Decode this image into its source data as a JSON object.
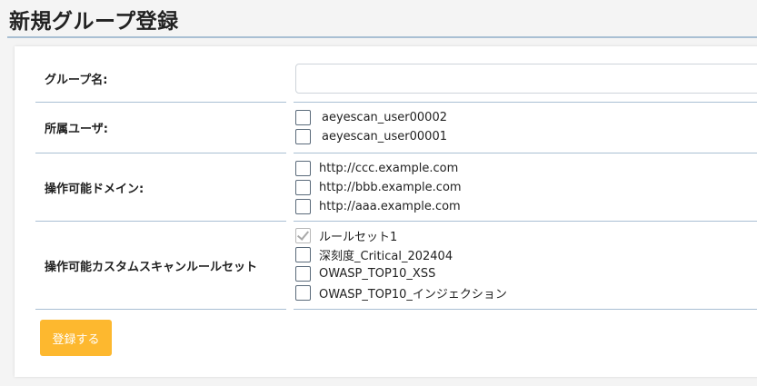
{
  "page": {
    "title": "新規グループ登録"
  },
  "form": {
    "group_name": {
      "label": "グループ名:",
      "value": "",
      "placeholder": ""
    },
    "users": {
      "label": "所属ユーザ:",
      "options": [
        {
          "label": "aeyescan_user00002",
          "checked": false
        },
        {
          "label": "aeyescan_user00001",
          "checked": false
        }
      ]
    },
    "domains": {
      "label": "操作可能ドメイン:",
      "options": [
        {
          "label": "http://ccc.example.com",
          "checked": false
        },
        {
          "label": "http://bbb.example.com",
          "checked": false
        },
        {
          "label": "http://aaa.example.com",
          "checked": false
        }
      ]
    },
    "rulesets": {
      "label": "操作可能カスタムスキャンルールセット",
      "options": [
        {
          "label": "ルールセット1",
          "checked": true
        },
        {
          "label": "深刻度_Critical_202404",
          "checked": false
        },
        {
          "label": "OWASP_TOP10_XSS",
          "checked": false
        },
        {
          "label": "OWASP_TOP10_インジェクション",
          "checked": false
        }
      ]
    },
    "submit_label": "登録する"
  },
  "colors": {
    "accent": "#fdb82f",
    "divider": "#a9bfd3"
  }
}
